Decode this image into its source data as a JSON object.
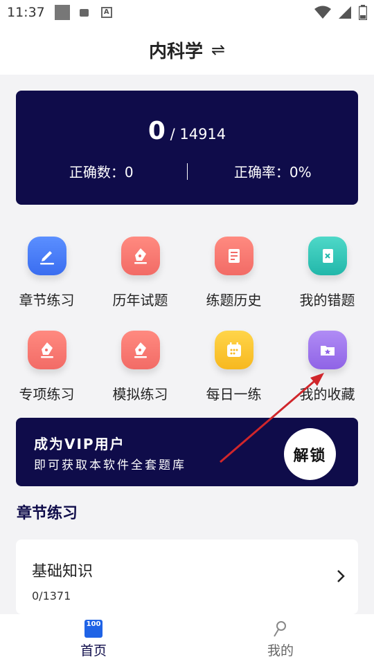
{
  "status_bar": {
    "time": "11:37"
  },
  "header": {
    "title": "内科学",
    "swap_glyph": "⇌"
  },
  "stats": {
    "done": "0",
    "separator": " / ",
    "total": "14914",
    "correct_count_label": "正确数：0",
    "correct_rate_label": "正确率：0%"
  },
  "features": [
    {
      "label": "章节练习",
      "icon": "pencil-edit-icon",
      "color": "#3f72f2"
    },
    {
      "label": "历年试题",
      "icon": "pen-nib-icon",
      "color": "#f26b66"
    },
    {
      "label": "练题历史",
      "icon": "notebook-icon",
      "color": "#f26b66"
    },
    {
      "label": "我的错题",
      "icon": "wrong-book-icon",
      "color": "#22b7aa"
    },
    {
      "label": "专项练习",
      "icon": "pen-nib-icon",
      "color": "#f26b66"
    },
    {
      "label": "模拟练习",
      "icon": "pen-nib-icon",
      "color": "#f26b66"
    },
    {
      "label": "每日一练",
      "icon": "calendar-icon",
      "color": "#f7b81f"
    },
    {
      "label": "我的收藏",
      "icon": "star-folder-icon",
      "color": "#8f63e6"
    }
  ],
  "vip": {
    "title": "成为VIP用户",
    "subtitle": "即可获取本软件全套题库",
    "unlock": "解锁"
  },
  "section": {
    "title": "章节练习"
  },
  "chapters": [
    {
      "name": "基础知识",
      "progress": "0/1371"
    }
  ],
  "tabbar": {
    "home": {
      "label": "首页",
      "icon_text": "100"
    },
    "mine": {
      "label": "我的"
    }
  },
  "colors": {
    "navy": "#0f0c4a",
    "annotation_arrow": "#d0262b"
  }
}
